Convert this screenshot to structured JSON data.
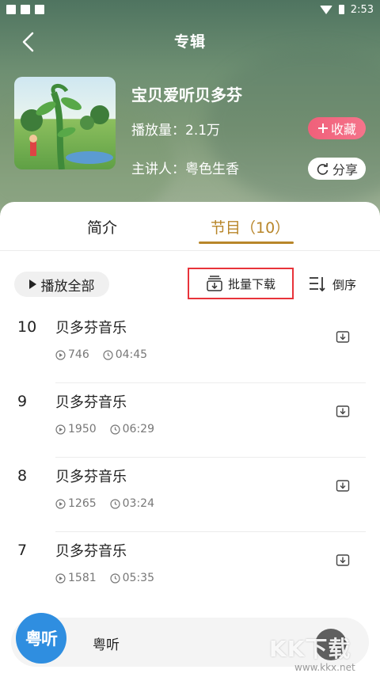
{
  "status_bar": {
    "time": "2:53"
  },
  "header": {
    "title": "专辑"
  },
  "album": {
    "name": "宝贝爱听贝多芬",
    "plays": "播放量：2.1万",
    "speaker": "主讲人：粤色生香",
    "favorite_label": "收藏",
    "share_label": "分享"
  },
  "tabs": [
    {
      "label": "简介"
    },
    {
      "label": "节目（10）"
    }
  ],
  "toolbar": {
    "play_all": "播放全部",
    "batch_download": "批量下载",
    "sort": "倒序"
  },
  "episodes": [
    {
      "num": "10",
      "title": "贝多芬音乐",
      "plays": "746",
      "duration": "04:45"
    },
    {
      "num": "9",
      "title": "贝多芬音乐",
      "plays": "1950",
      "duration": "06:29"
    },
    {
      "num": "8",
      "title": "贝多芬音乐",
      "plays": "1265",
      "duration": "03:24"
    },
    {
      "num": "7",
      "title": "贝多芬音乐",
      "plays": "1581",
      "duration": "05:35"
    }
  ],
  "player": {
    "logo_text": "粤听",
    "name": "粤听"
  },
  "watermark": {
    "text": "KK下载",
    "url": "www.kkx.net"
  },
  "colors": {
    "accent": "#b8862a",
    "favorite": "#f0607a",
    "highlight_box": "#e8333a",
    "logo": "#2f8ee0"
  }
}
